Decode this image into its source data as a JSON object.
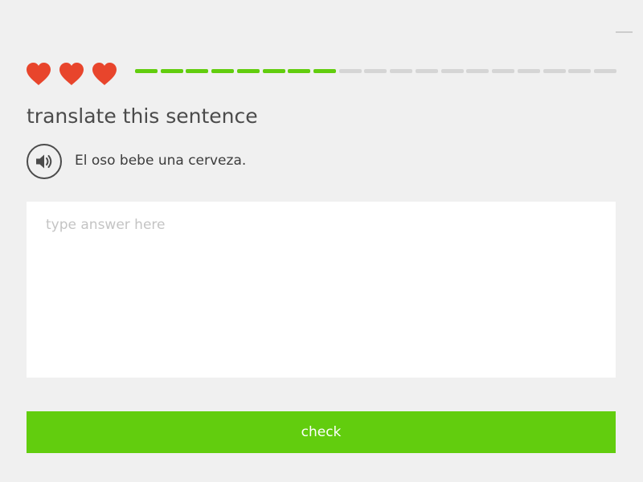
{
  "window": {
    "minimize_icon": "minimize-icon"
  },
  "lesson": {
    "hearts": {
      "count": 3,
      "icon": "heart-icon",
      "color": "#e8452c"
    },
    "progress": {
      "completed_segments": 8,
      "total_segments": 19,
      "done_color": "#62cd0e",
      "remaining_color": "#d5d5d5"
    },
    "instruction": "translate this sentence",
    "speaker_icon": "speaker-icon",
    "sentence": "El oso bebe una cerveza.",
    "answer": {
      "value": "",
      "placeholder": "type answer here"
    },
    "check_label": "check",
    "check_color": "#62cd0e"
  }
}
